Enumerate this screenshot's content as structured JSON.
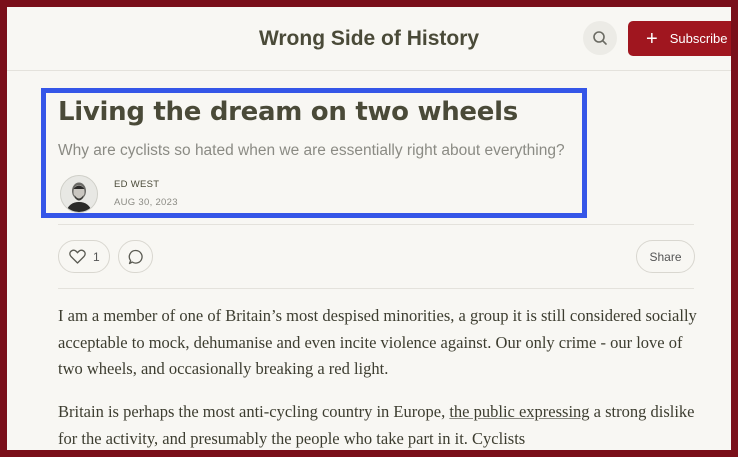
{
  "header": {
    "site_title": "Wrong Side of History",
    "subscribe_label": "Subscribe",
    "search_icon": "search-icon"
  },
  "post": {
    "title": "Living the dream on two wheels",
    "subtitle": "Why are cyclists so hated when we are essentially right about everything?",
    "author": "ED WEST",
    "date": "AUG 30, 2023"
  },
  "actions": {
    "like_count": "1",
    "share_label": "Share"
  },
  "body": {
    "p1": "I am a member of one of Britain’s most despised minorities, a group it is still considered socially acceptable to mock, dehumanise and even incite violence against. Our only crime - our love of two wheels, and occasionally breaking a red light.",
    "p2_before": "Britain is perhaps the most anti-cycling country in Europe, ",
    "p2_link": "the public expressing",
    "p2_after": " a strong dislike for the activity, and presumably the people who take part in it. Cyclists"
  },
  "colors": {
    "brand": "#a0161f",
    "highlight": "#3556e8",
    "frame": "#7a0f1a"
  }
}
